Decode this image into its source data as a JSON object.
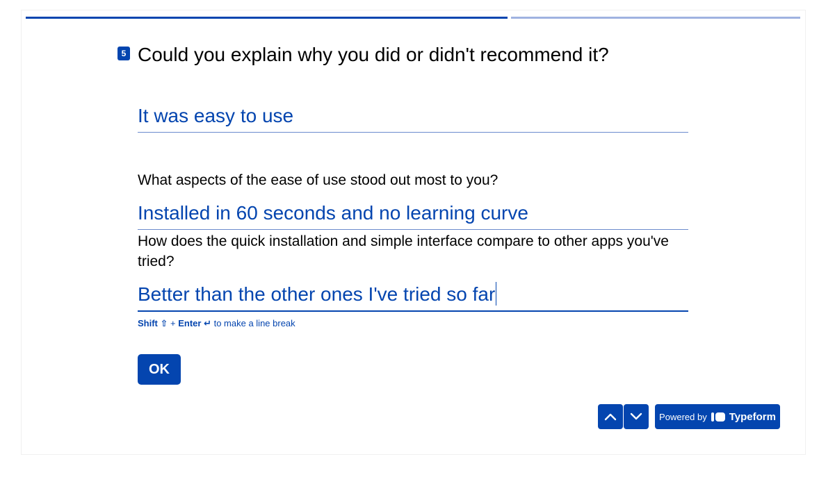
{
  "progress": {
    "fraction": 0.62
  },
  "question": {
    "number": "5",
    "text": "Could you explain why you did or didn't recommend it?"
  },
  "answers": [
    {
      "text": "It was easy to use"
    },
    {
      "text": "Installed in 60 seconds and no learning curve"
    },
    {
      "text": "Better than the other ones I've tried so far"
    }
  ],
  "followups": [
    {
      "text": "What aspects of the ease of use stood out most to you?"
    },
    {
      "text": "How does the quick installation and simple interface compare to other apps you've tried?"
    }
  ],
  "hint": {
    "shift": "Shift ⇧",
    "plus": "+",
    "enter": "Enter ↵",
    "rest": "to make a line break"
  },
  "ok_label": "OK",
  "powered": {
    "prefix": "Powered by",
    "brand": "Typeform"
  },
  "colors": {
    "accent": "#0445af",
    "progress_rest": "#9fb2e0"
  }
}
